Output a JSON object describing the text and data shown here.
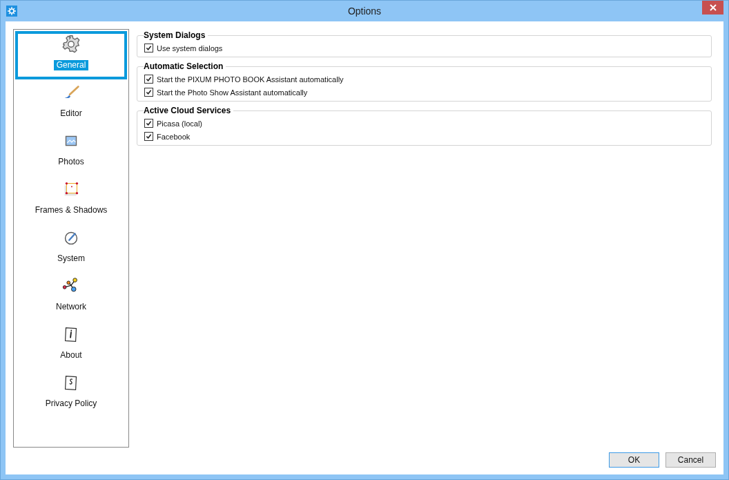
{
  "window": {
    "title": "Options"
  },
  "sidebar": {
    "items": [
      {
        "label": "General",
        "kind": "gear",
        "selected": true
      },
      {
        "label": "Editor",
        "kind": "brush",
        "selected": false
      },
      {
        "label": "Photos",
        "kind": "picture",
        "selected": false
      },
      {
        "label": "Frames & Shadows",
        "kind": "frame",
        "selected": false
      },
      {
        "label": "System",
        "kind": "dial",
        "selected": false
      },
      {
        "label": "Network",
        "kind": "network",
        "selected": false
      },
      {
        "label": "About",
        "kind": "info",
        "selected": false
      },
      {
        "label": "Privacy Policy",
        "kind": "paragraph",
        "selected": false
      }
    ]
  },
  "groups": [
    {
      "title": "System Dialogs",
      "options": [
        {
          "label": "Use system dialogs",
          "checked": true
        }
      ]
    },
    {
      "title": "Automatic Selection",
      "options": [
        {
          "label": "Start the PIXUM PHOTO BOOK Assistant automatically",
          "checked": true
        },
        {
          "label": "Start the Photo Show Assistant automatically",
          "checked": true
        }
      ]
    },
    {
      "title": "Active Cloud Services",
      "options": [
        {
          "label": "Picasa (local)",
          "checked": true
        },
        {
          "label": "Facebook",
          "checked": true
        }
      ]
    }
  ],
  "buttons": [
    {
      "label": "OK",
      "default": true
    },
    {
      "label": "Cancel",
      "default": false
    }
  ]
}
